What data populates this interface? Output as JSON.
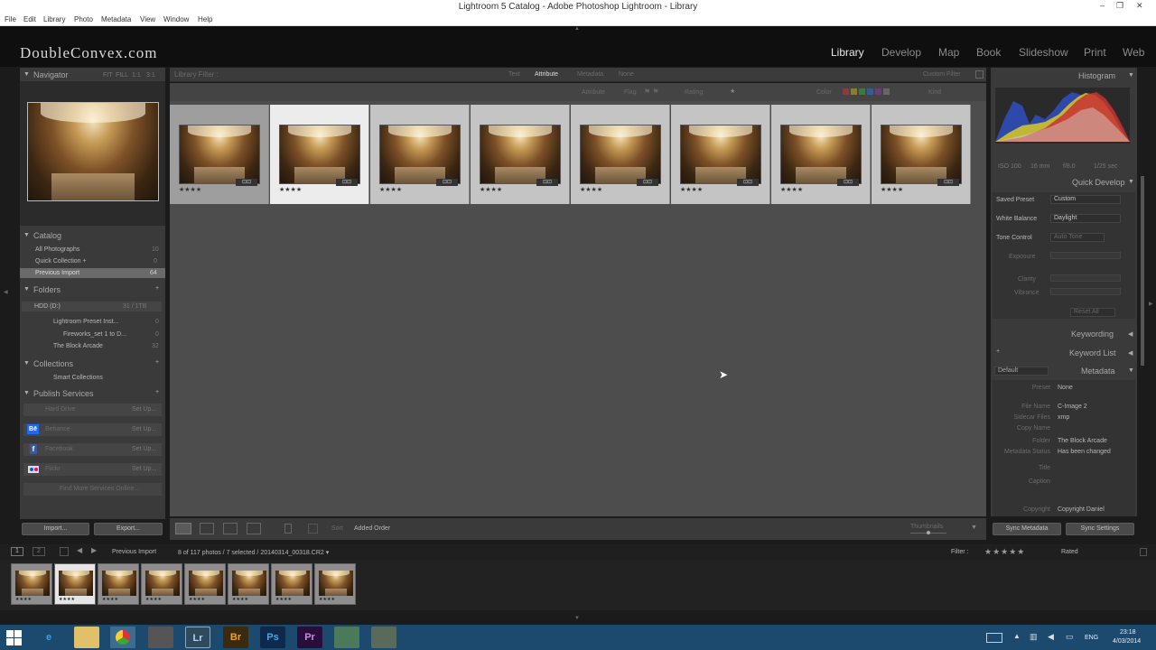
{
  "window": {
    "title": "Lightroom 5 Catalog - Adobe Photoshop Lightroom - Library",
    "minimize": "–",
    "restore": "❐",
    "close": "✕"
  },
  "menu": [
    "File",
    "Edit",
    "Library",
    "Photo",
    "Metadata",
    "View",
    "Window",
    "Help"
  ],
  "brand": "DoubleConvex.com",
  "modules": [
    "Library",
    "Develop",
    "Map",
    "Book",
    "Slideshow",
    "Print",
    "Web"
  ],
  "active_module": "Library",
  "left": {
    "navigator": {
      "title": "Navigator",
      "zoom_opts": [
        "FIT",
        "FILL",
        "1:1",
        "3:1"
      ]
    },
    "catalog": {
      "title": "Catalog",
      "items": [
        {
          "label": "All Photographs",
          "count": "10"
        },
        {
          "label": "Quick Collection +",
          "count": "0"
        },
        {
          "label": "Previous Import",
          "count": "64"
        }
      ]
    },
    "folders": {
      "title": "Folders",
      "drive": {
        "label": "HDD (D:)",
        "info": "31 / 1TB"
      },
      "items": [
        {
          "label": "Lightroom Preset Inst...",
          "count": "0"
        },
        {
          "label": "Fireworks_set 1 to D...",
          "count": "0"
        },
        {
          "label": "The Block Arcade",
          "count": "32"
        }
      ]
    },
    "collections": {
      "title": "Collections",
      "items": [
        {
          "label": "Smart Collections"
        }
      ]
    },
    "publish": {
      "title": "Publish Services",
      "items": [
        {
          "label": "Hard Drive",
          "action": "Set Up..."
        },
        {
          "label": "Behance",
          "action": "Set Up..."
        },
        {
          "label": "Facebook",
          "action": "Set Up..."
        },
        {
          "label": "Flickr",
          "action": "Set Up..."
        }
      ],
      "find_more": "Find More Services Online..."
    },
    "import_label": "Import...",
    "export_label": "Export..."
  },
  "filter": {
    "label": "Library Filter :",
    "tabs": [
      "Text",
      "Attribute",
      "Metadata",
      "None"
    ],
    "active_tab": "Attribute",
    "preset": "Custom Filter",
    "attr_label": "Attribute",
    "flag_label": "Flag",
    "rating_label": "Rating",
    "color_label": "Color",
    "kind_label": "Kind"
  },
  "grid": {
    "count": 8,
    "stars": "★★★★",
    "badge": "⊡⊡"
  },
  "toolbar": {
    "sort_label": "Sort",
    "sort_value": "Added Order",
    "thumbs_label": "Thumbnails"
  },
  "right": {
    "histogram": {
      "title": "Histogram",
      "readouts": [
        "ISO 100",
        "16 mm",
        "f/8.0",
        "1/25 sec"
      ]
    },
    "quick_develop": {
      "title": "Quick Develop",
      "saved_preset": {
        "label": "Saved Preset",
        "value": "Custom"
      },
      "white_balance": {
        "label": "White Balance",
        "value": "Daylight"
      },
      "tone_control": {
        "label": "Tone Control",
        "value": "Auto Tone"
      },
      "rows": [
        {
          "label": "Exposure"
        },
        {
          "label": "Clarity"
        },
        {
          "label": "Vibrance"
        }
      ],
      "reset": "Reset All"
    },
    "keywording": {
      "title": "Keywording"
    },
    "keyword_list": {
      "title": "Keyword List"
    },
    "metadata": {
      "title": "Metadata",
      "preset": "Default",
      "rows": [
        {
          "label": "Preset",
          "value": "None"
        },
        {
          "label": "File Name",
          "value": "C-Image 2"
        },
        {
          "label": "Sidecar Files",
          "value": "xmp"
        },
        {
          "label": "Copy Name",
          "value": ""
        },
        {
          "label": "Folder",
          "value": "The Block Arcade"
        },
        {
          "label": "Metadata Status",
          "value": "Has been changed"
        },
        {
          "label": "Title",
          "value": ""
        },
        {
          "label": "Caption",
          "value": ""
        },
        {
          "label": "Copyright",
          "value": "Copyright Daniel"
        }
      ]
    },
    "sync_metadata": "Sync Metadata",
    "sync_settings": "Sync Settings"
  },
  "filmstrip": {
    "source": "Previous Import",
    "info": "8 of 117 photos / 7 selected / 20140314_00318.CR2 ▾",
    "filter_label": "Filter :",
    "rated_label": "Rated",
    "stars": "★★★★★",
    "count": 8
  },
  "taskbar": {
    "apps": [
      "Lr",
      "Br",
      "Ps",
      "Pr"
    ],
    "time": "23:18",
    "date": "4/03/2014",
    "lang": "ENG"
  },
  "colors": {
    "accent": "#e8e8e8",
    "panel": "#3a3a3a",
    "grid_bg": "#4a4a4a",
    "taskbar": "#1c4a6e"
  }
}
